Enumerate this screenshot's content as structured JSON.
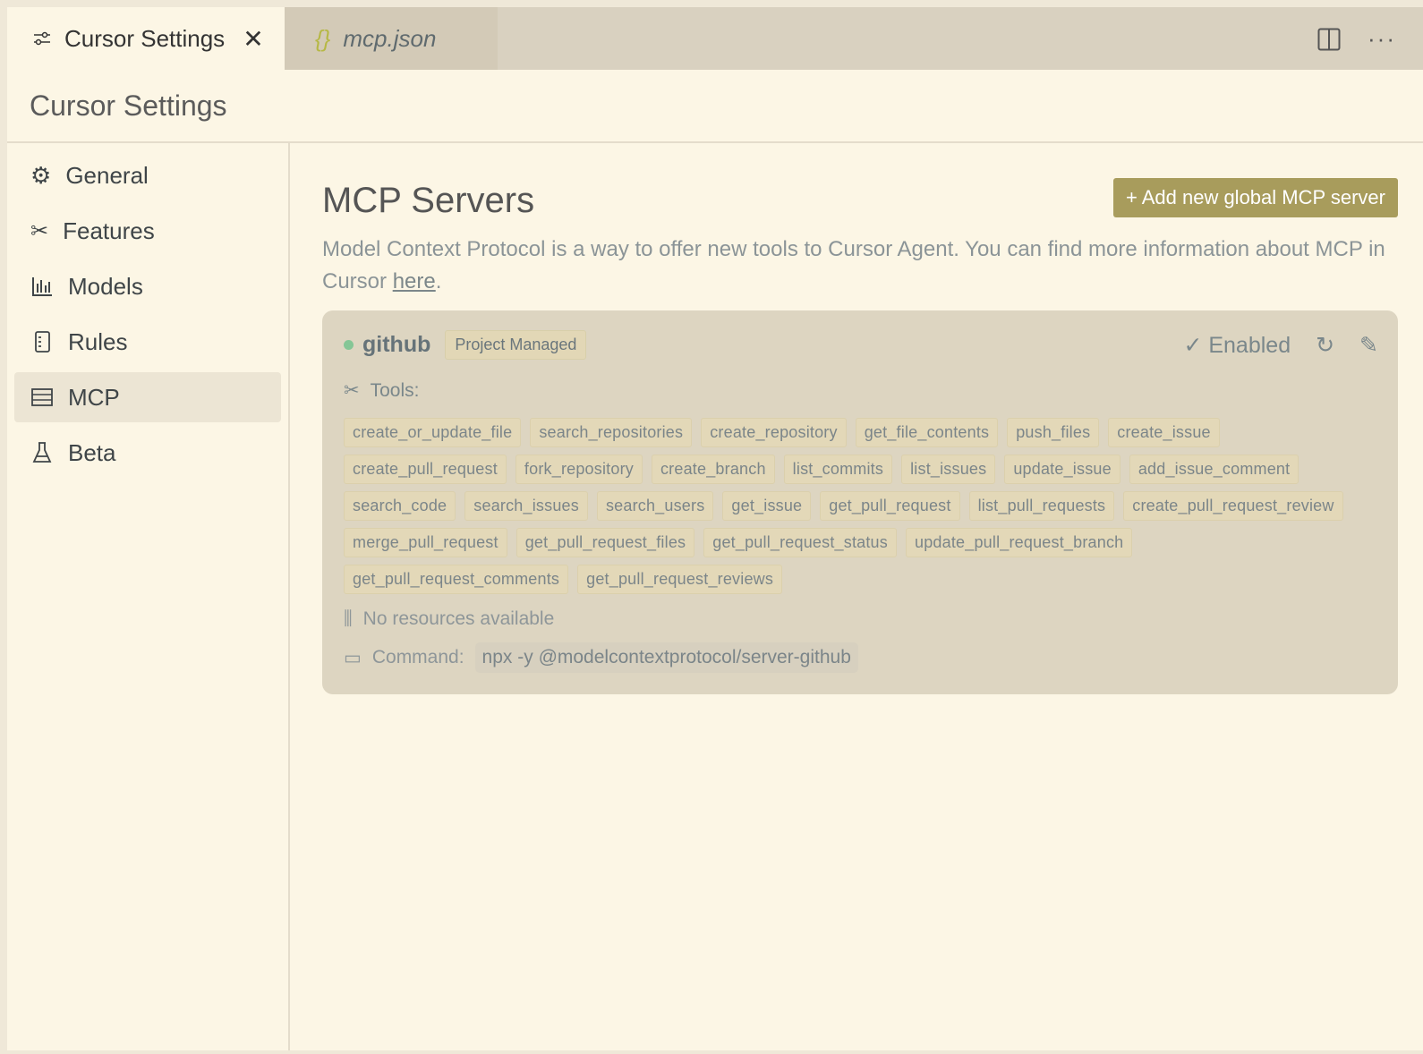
{
  "tabs": [
    {
      "label": "Cursor Settings",
      "icon": "sliders-icon",
      "active": true
    },
    {
      "label": "mcp.json",
      "icon": "braces-icon",
      "active": false
    }
  ],
  "header": {
    "title": "Cursor Settings"
  },
  "sidebar": {
    "items": [
      {
        "label": "General",
        "icon": "gear-icon"
      },
      {
        "label": "Features",
        "icon": "tools-icon"
      },
      {
        "label": "Models",
        "icon": "bar-chart-icon"
      },
      {
        "label": "Rules",
        "icon": "document-icon"
      },
      {
        "label": "MCP",
        "icon": "server-icon",
        "selected": true
      },
      {
        "label": "Beta",
        "icon": "flask-icon"
      }
    ]
  },
  "main": {
    "title": "MCP Servers",
    "add_button": "+ Add new global MCP server",
    "description": "Model Context Protocol is a way to offer new tools to Cursor Agent. You can find more information about MCP in Cursor ",
    "link": "here",
    "link_suffix": ".",
    "server": {
      "name": "github",
      "status_color": "#85c696",
      "badge": "Project Managed",
      "enabled_label": "Enabled",
      "tools_label": "Tools:",
      "tools": [
        "create_or_update_file",
        "search_repositories",
        "create_repository",
        "get_file_contents",
        "push_files",
        "create_issue",
        "create_pull_request",
        "fork_repository",
        "create_branch",
        "list_commits",
        "list_issues",
        "update_issue",
        "add_issue_comment",
        "search_code",
        "search_issues",
        "search_users",
        "get_issue",
        "get_pull_request",
        "list_pull_requests",
        "create_pull_request_review",
        "merge_pull_request",
        "get_pull_request_files",
        "get_pull_request_status",
        "update_pull_request_branch",
        "get_pull_request_comments",
        "get_pull_request_reviews"
      ],
      "resources": "No resources available",
      "command_label": "Command:",
      "command": "npx -y @modelcontextprotocol/server-github"
    }
  },
  "colors": {
    "accent": "#a89c5c",
    "background": "#fcf6e5"
  }
}
